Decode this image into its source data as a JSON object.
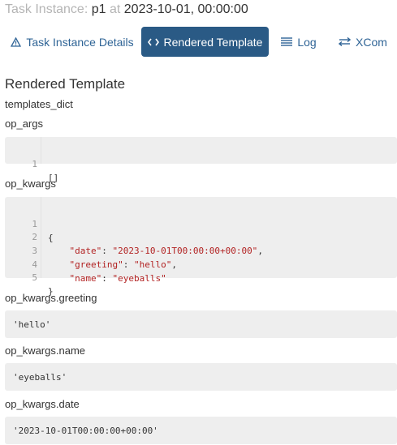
{
  "header": {
    "prefix": "Task Instance:",
    "task_id": "p1",
    "at_word": "at",
    "run_date": "2023-10-01, 00:00:00"
  },
  "tabs": [
    {
      "label": "Task Instance Details",
      "icon": "warning-triangle-icon",
      "active": false
    },
    {
      "label": "Rendered Template",
      "icon": "code-brackets-icon",
      "active": true
    },
    {
      "label": "Log",
      "icon": "list-lines-icon",
      "active": false
    },
    {
      "label": "XCom",
      "icon": "swap-arrows-icon",
      "active": false
    }
  ],
  "section_title": "Rendered Template",
  "fields": {
    "templates_dict": {
      "label": "templates_dict"
    },
    "op_args": {
      "label": "op_args",
      "lines": [
        {
          "num": "1",
          "text": "[]"
        }
      ]
    },
    "op_kwargs": {
      "label": "op_kwargs",
      "lines": [
        {
          "num": "1",
          "text": "{"
        },
        {
          "num": "2",
          "key": "\"date\"",
          "value": "\"2023-10-01T00:00:00+00:00\"",
          "trail": ","
        },
        {
          "num": "3",
          "key": "\"greeting\"",
          "value": "\"hello\"",
          "trail": ","
        },
        {
          "num": "4",
          "key": "\"name\"",
          "value": "\"eyeballs\"",
          "trail": ""
        },
        {
          "num": "5",
          "text": "}"
        }
      ]
    },
    "greeting": {
      "label": "op_kwargs.greeting",
      "value": "'hello'"
    },
    "name": {
      "label": "op_kwargs.name",
      "value": "'eyeballs'"
    },
    "date": {
      "label": "op_kwargs.date",
      "value": "'2023-10-01T00:00:00+00:00'"
    }
  }
}
